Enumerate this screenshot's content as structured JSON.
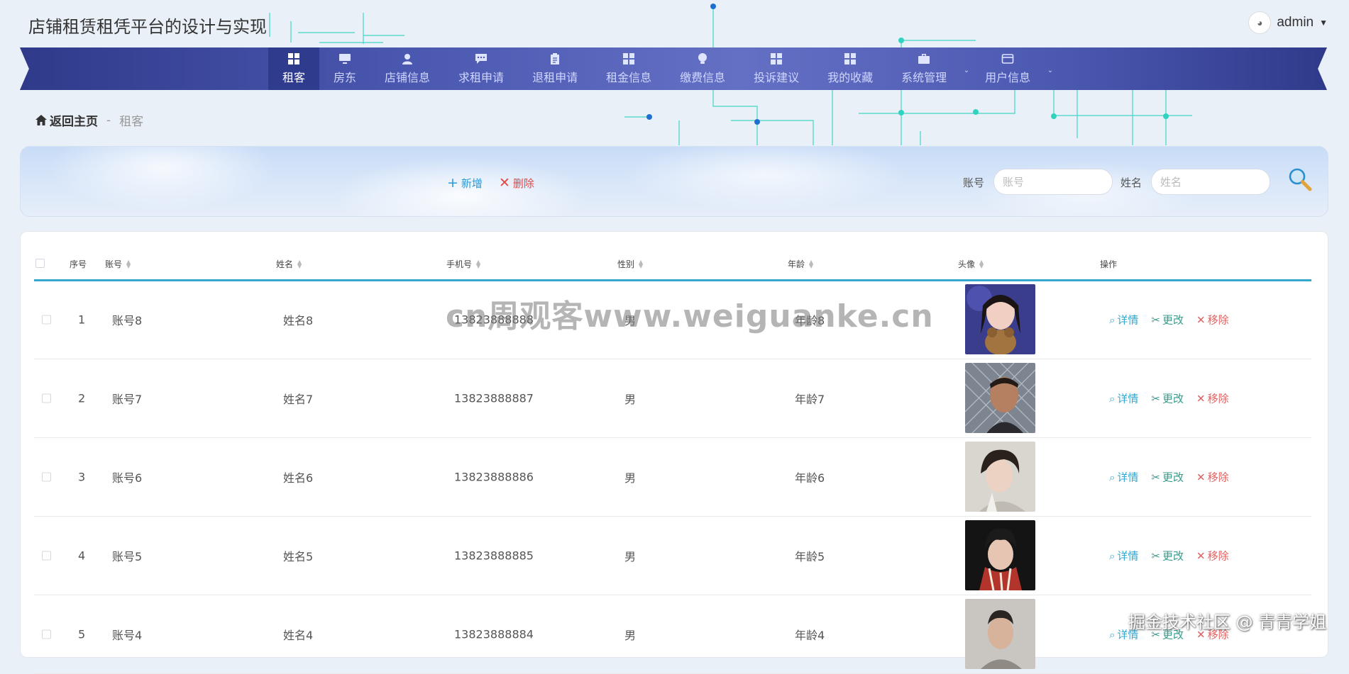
{
  "app": {
    "title": "店铺租赁租凭平台的设计与实现"
  },
  "user": {
    "name": "admin"
  },
  "nav": [
    {
      "label": "租客",
      "icon": "grid-icon",
      "active": true
    },
    {
      "label": "房东",
      "icon": "monitor-icon"
    },
    {
      "label": "店铺信息",
      "icon": "user-icon"
    },
    {
      "label": "求租申请",
      "icon": "chat-icon"
    },
    {
      "label": "退租申请",
      "icon": "clipboard-icon"
    },
    {
      "label": "租金信息",
      "icon": "grid-icon"
    },
    {
      "label": "缴费信息",
      "icon": "bulb-icon"
    },
    {
      "label": "投诉建议",
      "icon": "grid-icon"
    },
    {
      "label": "我的收藏",
      "icon": "grid-icon"
    },
    {
      "label": "系统管理",
      "icon": "briefcase-icon",
      "dropdown": true
    },
    {
      "label": "用户信息",
      "icon": "card-icon",
      "dropdown": true
    }
  ],
  "breadcrumb": {
    "home": "返回主页",
    "separator": "-",
    "current": "租客"
  },
  "toolbar": {
    "add": "新增",
    "delete": "删除"
  },
  "search": {
    "account_label": "账号",
    "account_placeholder": "账号",
    "name_label": "姓名",
    "name_placeholder": "姓名"
  },
  "table": {
    "columns": [
      "序号",
      "账号",
      "姓名",
      "手机号",
      "性别",
      "年龄",
      "头像",
      "操作"
    ],
    "actions": {
      "detail": "详情",
      "edit": "更改",
      "remove": "移除"
    },
    "rows": [
      {
        "index": "1",
        "account": "账号8",
        "name": "姓名8",
        "phone": "13823888888",
        "gender": "男",
        "age": "年龄8"
      },
      {
        "index": "2",
        "account": "账号7",
        "name": "姓名7",
        "phone": "13823888887",
        "gender": "男",
        "age": "年龄7"
      },
      {
        "index": "3",
        "account": "账号6",
        "name": "姓名6",
        "phone": "13823888886",
        "gender": "男",
        "age": "年龄6"
      },
      {
        "index": "4",
        "account": "账号5",
        "name": "姓名5",
        "phone": "13823888885",
        "gender": "男",
        "age": "年龄5"
      },
      {
        "index": "5",
        "account": "账号4",
        "name": "姓名4",
        "phone": "13823888884",
        "gender": "男",
        "age": "年龄4"
      }
    ]
  },
  "watermarks": {
    "center": "cn周观客www.weiguanke.cn",
    "corner": "掘金技术社区 @ 青青学姐"
  },
  "colors": {
    "nav_bg": "#4b58b0",
    "nav_active": "#2f3b8c",
    "accent": "#35a8d0",
    "danger": "#e04848"
  }
}
